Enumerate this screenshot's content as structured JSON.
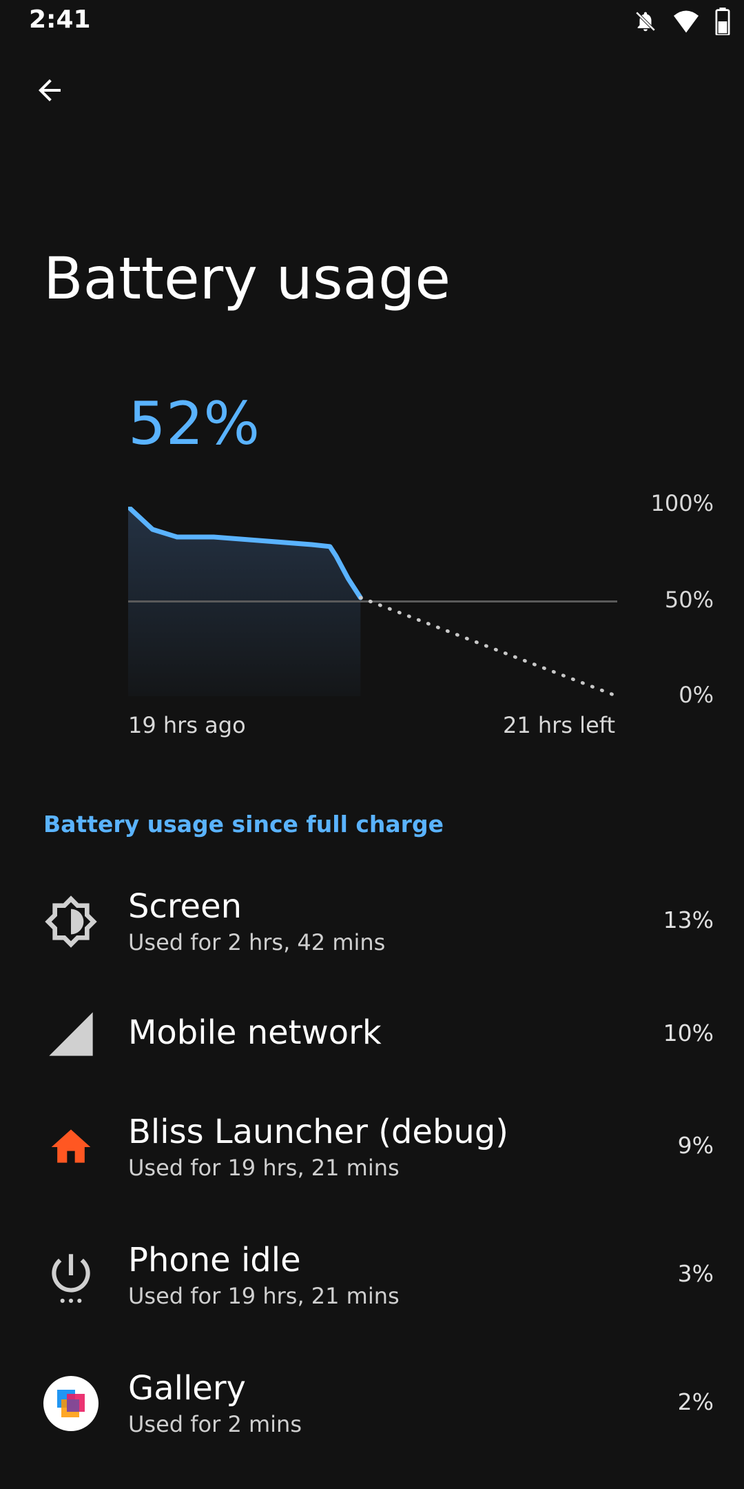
{
  "status_bar": {
    "time": "2:41",
    "icons": [
      "notifications-off-icon",
      "wifi-icon",
      "battery-icon"
    ]
  },
  "toolbar": {
    "back_icon": "arrow-back-icon"
  },
  "page": {
    "title": "Battery usage"
  },
  "battery": {
    "level": "52%",
    "y_labels": [
      "100%",
      "50%",
      "0%"
    ],
    "x_label_left": "19 hrs ago",
    "x_label_right": "21 hrs left",
    "accent_color": "#5ab3ff"
  },
  "chart_data": {
    "type": "line",
    "x": [
      -19,
      -18.5,
      -17,
      -15,
      -12,
      -10,
      -8,
      -6,
      -4,
      -2.5,
      -2,
      -1,
      0
    ],
    "series": [
      {
        "values": [
          100,
          97,
          88,
          84,
          84,
          83,
          82,
          81,
          80,
          79,
          74,
          62,
          52
        ]
      },
      {
        "values": [
          52,
          0
        ],
        "x": [
          0,
          21
        ],
        "style": "dotted"
      }
    ],
    "ylim": [
      0,
      100
    ],
    "y_ticks": [
      "100%",
      "50%",
      "0%"
    ],
    "x_ticks": [
      "19 hrs ago",
      "21 hrs left"
    ]
  },
  "section": {
    "header": "Battery usage since full charge"
  },
  "usage_list": [
    {
      "icon": "brightness-icon",
      "title": "Screen",
      "summary": "Used for 2 hrs, 42 mins",
      "percent": "13%"
    },
    {
      "icon": "signal-cellular-icon",
      "title": "Mobile network",
      "summary": "",
      "percent": "10%"
    },
    {
      "icon": "home-icon",
      "title": "Bliss Launcher (debug)",
      "summary": "Used for 19 hrs, 21 mins",
      "percent": "9%",
      "icon_color": "#ff5722"
    },
    {
      "icon": "power-icon",
      "title": "Phone idle",
      "summary": "Used for 19 hrs, 21 mins",
      "percent": "3%"
    },
    {
      "icon": "gallery-icon",
      "title": "Gallery",
      "summary": "Used for 2 mins",
      "percent": "2%"
    }
  ]
}
